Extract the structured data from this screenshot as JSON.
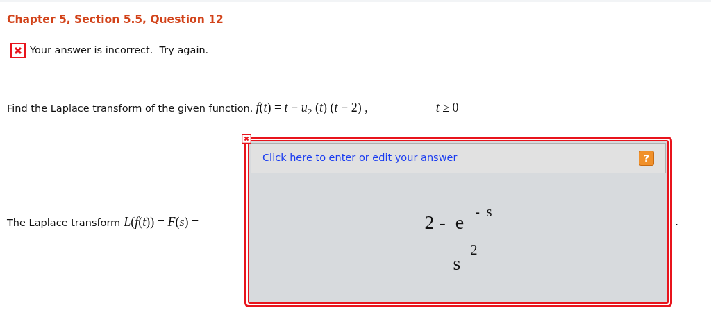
{
  "title": "Chapter 5, Section 5.5, Question 12",
  "feedback": {
    "correct": false,
    "message": "Your answer is incorrect.  Try again."
  },
  "question": {
    "text": "Find the Laplace transform of the given function.",
    "formula": "*f*(*t*) = *t* − *u*$_{2}$ (*t*) (*t* − 2) ,",
    "condition": "*t* ≥ 0"
  },
  "answer": {
    "label": "The Laplace transform",
    "label_formula": "*L*(*f*(*t*)) = *F*(*s*) =",
    "correct": false,
    "link": "Click here to enter or edit your answer",
    "help": "?",
    "numerator": "2 -  e",
    "numerator_exp": "-  s",
    "denominator": "s",
    "denominator_exp": "2",
    "trailing": "."
  }
}
